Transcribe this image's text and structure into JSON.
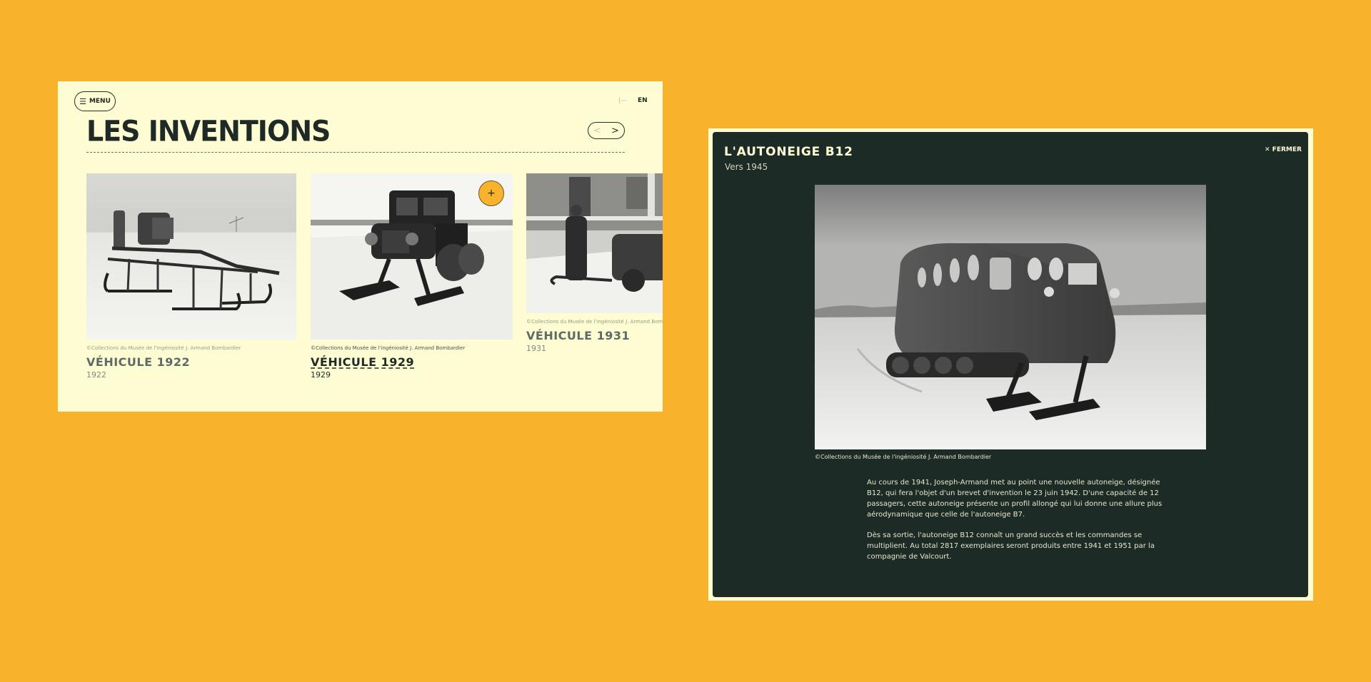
{
  "left_panel": {
    "menu_label": "MENU",
    "lang_inactive": "|—",
    "lang_active": "EN",
    "title": "LES INVENTIONS",
    "prev_arrow": "<",
    "next_arrow": ">",
    "cards": [
      {
        "credit": "©Collections du Musée de l'ingéniosité J. Armand Bombardier",
        "name": "VÉHICULE 1922",
        "year": "1922"
      },
      {
        "credit": "©Collections du Musée de l'ingéniosité J. Armand Bombardier",
        "name": "VÉHICULE 1929",
        "year": "1929",
        "plus": "+"
      },
      {
        "credit": "©Collections du Musée de l'ingéniosité J. Armand Bombardier",
        "name": "VÉHICULE 1931",
        "year": "1931"
      }
    ]
  },
  "dialog": {
    "title": "L'AUTONEIGE B12",
    "subtitle": "Vers 1945",
    "close_label": "✕ FERMER",
    "photo_credit": "©Collections du Musée de l'ingéniosité J. Armand Bombardier",
    "paragraphs": [
      "Au cours de 1941, Joseph-Armand met au point une nouvelle autoneige, désignée B12, qui fera l'objet d'un brevet d'invention le 23 juin 1942. D'une capacité de 12 passagers, cette autoneige présente un profil allongé qui lui donne une allure plus aérodynamique que celle de l'autoneige B7.",
      "Dès sa sortie, l'autoneige B12 connaît un grand succès et les commandes se multiplient. Au total 2817 exemplaires seront produits entre 1941 et 1951 par la compagnie de Valcourt."
    ]
  },
  "colors": {
    "background": "#F8B22B",
    "panel_cream": "#FEFCD3",
    "dialog_dark": "#1C2B26",
    "accent": "#F8B22B"
  }
}
